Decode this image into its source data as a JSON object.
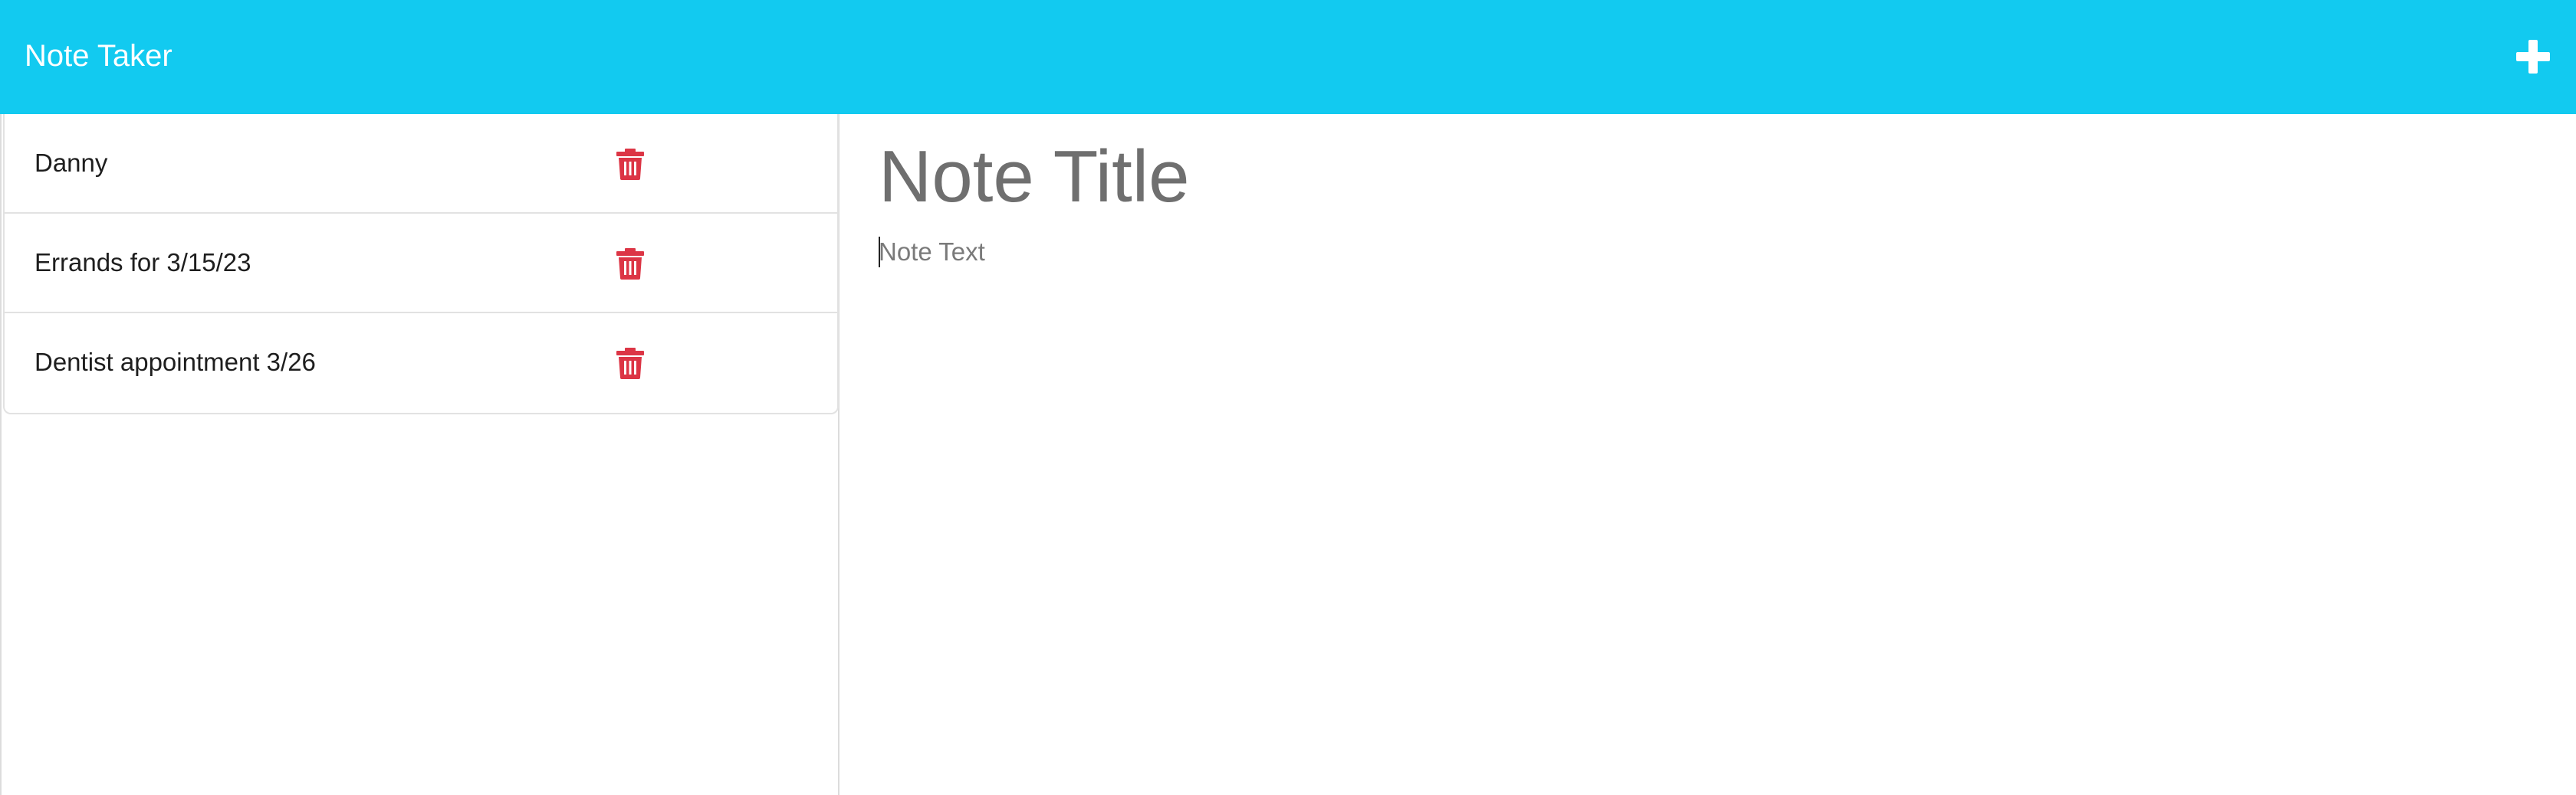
{
  "header": {
    "brand": "Note Taker",
    "new_note_icon": "plus-icon"
  },
  "notes": [
    {
      "title": "Danny",
      "delete_icon": "trash-icon"
    },
    {
      "title": "Errands for 3/15/23",
      "delete_icon": "trash-icon"
    },
    {
      "title": "Dentist appointment 3/26",
      "delete_icon": "trash-icon"
    }
  ],
  "editor": {
    "title_placeholder": "Note Title",
    "text_placeholder": "Note Text"
  },
  "colors": {
    "navbar": "#12caf0",
    "delete": "#dc3545",
    "placeholder": "#6f6f6f"
  }
}
